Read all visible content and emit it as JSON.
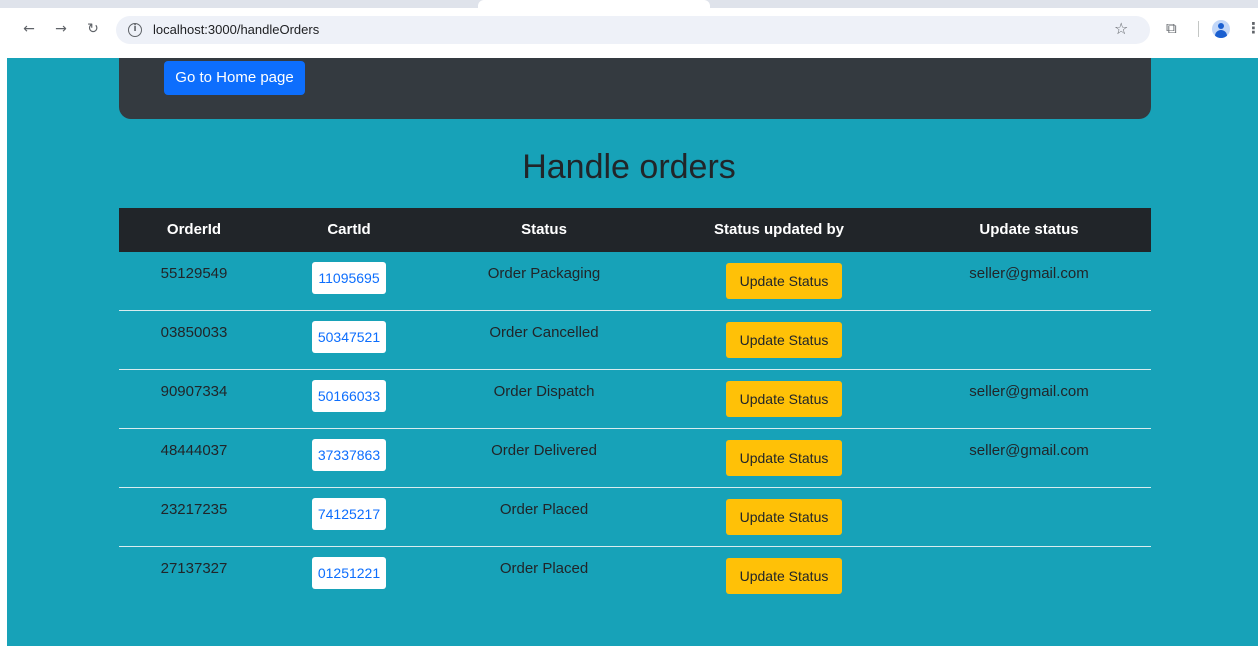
{
  "browser": {
    "url": "localhost:3000/handleOrders"
  },
  "navbar": {
    "home_button": "Go to Home page"
  },
  "page_title": "Handle orders",
  "table": {
    "headers": [
      "OrderId",
      "CartId",
      "Status",
      "Status updated by",
      "Update status"
    ],
    "rows": [
      {
        "order_id": "55129549",
        "cart_id": "11095695",
        "status": "Order Packaging",
        "action": "Update Status",
        "updated_by": "seller@gmail.com"
      },
      {
        "order_id": "03850033",
        "cart_id": "50347521",
        "status": "Order Cancelled",
        "action": "Update Status",
        "updated_by": ""
      },
      {
        "order_id": "90907334",
        "cart_id": "50166033",
        "status": "Order Dispatch",
        "action": "Update Status",
        "updated_by": "seller@gmail.com"
      },
      {
        "order_id": "48444037",
        "cart_id": "37337863",
        "status": "Order Delivered",
        "action": "Update Status",
        "updated_by": "seller@gmail.com"
      },
      {
        "order_id": "23217235",
        "cart_id": "74125217",
        "status": "Order Placed",
        "action": "Update Status",
        "updated_by": ""
      },
      {
        "order_id": "27137327",
        "cart_id": "01251221",
        "status": "Order Placed",
        "action": "Update Status",
        "updated_by": ""
      }
    ]
  },
  "colors": {
    "page_bg": "#17a2b8",
    "navbar_bg": "#343a40",
    "header_bg": "#212529",
    "primary": "#0d6efd",
    "warning": "#ffc107"
  }
}
